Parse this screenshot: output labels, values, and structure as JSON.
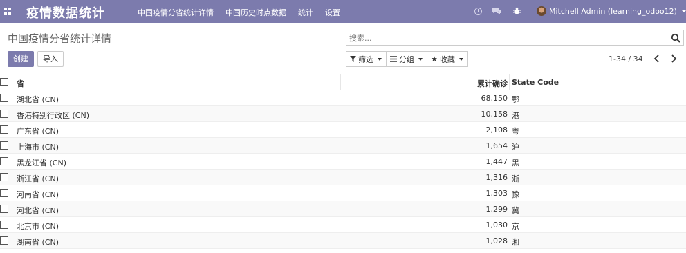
{
  "navbar": {
    "brand": "疫情数据统计",
    "menu": [
      "中国疫情分省统计详情",
      "中国历史时点数据",
      "统计",
      "设置"
    ],
    "user": "Mitchell Admin (learning_odoo12)",
    "color": "#7c7bad"
  },
  "control": {
    "title": "中国疫情分省统计详情",
    "create_label": "创建",
    "import_label": "导入",
    "search_placeholder": "搜索...",
    "filter_label": "筛选",
    "group_label": "分组",
    "favorite_label": "收藏",
    "pager": "1-34 / 34"
  },
  "table": {
    "headers": {
      "province": "省",
      "confirmed": "累计确诊",
      "state_code": "State Code"
    },
    "rows": [
      {
        "province": "湖北省 (CN)",
        "confirmed": "68,150",
        "code": "鄂"
      },
      {
        "province": "香港特别行政区 (CN)",
        "confirmed": "10,158",
        "code": "港"
      },
      {
        "province": "广东省 (CN)",
        "confirmed": "2,108",
        "code": "粤"
      },
      {
        "province": "上海市 (CN)",
        "confirmed": "1,654",
        "code": "沪"
      },
      {
        "province": "黑龙江省 (CN)",
        "confirmed": "1,447",
        "code": "黑"
      },
      {
        "province": "浙江省 (CN)",
        "confirmed": "1,316",
        "code": "浙"
      },
      {
        "province": "河南省 (CN)",
        "confirmed": "1,303",
        "code": "豫"
      },
      {
        "province": "河北省 (CN)",
        "confirmed": "1,299",
        "code": "冀"
      },
      {
        "province": "北京市 (CN)",
        "confirmed": "1,030",
        "code": "京"
      },
      {
        "province": "湖南省 (CN)",
        "confirmed": "1,028",
        "code": "湘"
      }
    ]
  }
}
